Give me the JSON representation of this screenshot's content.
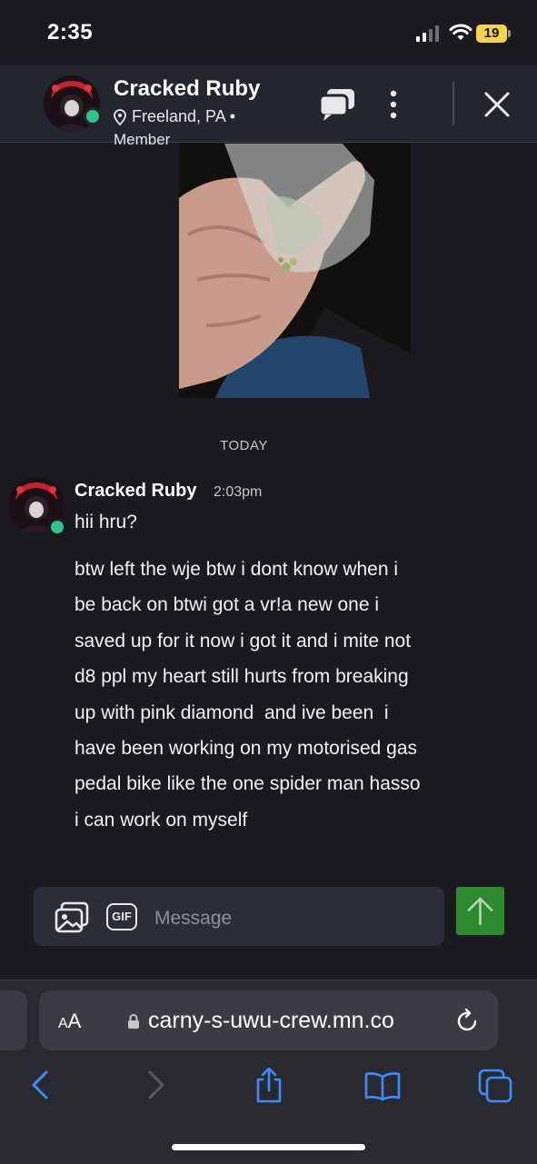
{
  "status_bar": {
    "time": "2:35",
    "battery_level": "19",
    "icons": [
      "cellular-signal-icon",
      "wifi-icon",
      "battery-icon"
    ]
  },
  "header": {
    "name": "Cracked Ruby",
    "location": "Freeland, PA  •",
    "role": "Member",
    "icons": [
      "avatar",
      "location-pin-icon",
      "chat-bubbles-icon",
      "more-vertical-icon",
      "close-icon"
    ]
  },
  "conversation": {
    "shared_image": "photo of a hand holding a small clear plastic bag",
    "day_separator": "TODAY",
    "message": {
      "author": "Cracked Ruby",
      "time": "2:03pm",
      "text_1": "hii hru?",
      "text_2_lines": [
        "btw left the wje btw i dont know when i",
        "be back on btwi got a vr!a new one i",
        "saved up for it now i got it and i mite not",
        "d8 ppl my heart still hurts from breaking",
        "up with pink diamond  and ive been  i",
        "have been working on my motorised gas",
        "pedal bike like the one spider man hasso",
        "i can work on myself"
      ]
    }
  },
  "composer": {
    "gif_label": "GIF",
    "placeholder": "Message",
    "icons": [
      "image-upload-icon",
      "arrow-up-icon"
    ]
  },
  "browser": {
    "text_size_label_small": "A",
    "text_size_label_large": "A",
    "url": "carny-s-uwu-crew.mn.co",
    "icons": [
      "lock-icon",
      "reload-icon",
      "back-icon",
      "forward-icon",
      "share-icon",
      "bookmarks-icon",
      "tabs-icon"
    ]
  },
  "colors": {
    "background": "#1b1a21",
    "header_bg": "#23262f",
    "online_dot": "#2fc58a",
    "send_button": "#2d8a2f",
    "browser_accent": "#3d8cff",
    "battery": "#f5d34a"
  }
}
